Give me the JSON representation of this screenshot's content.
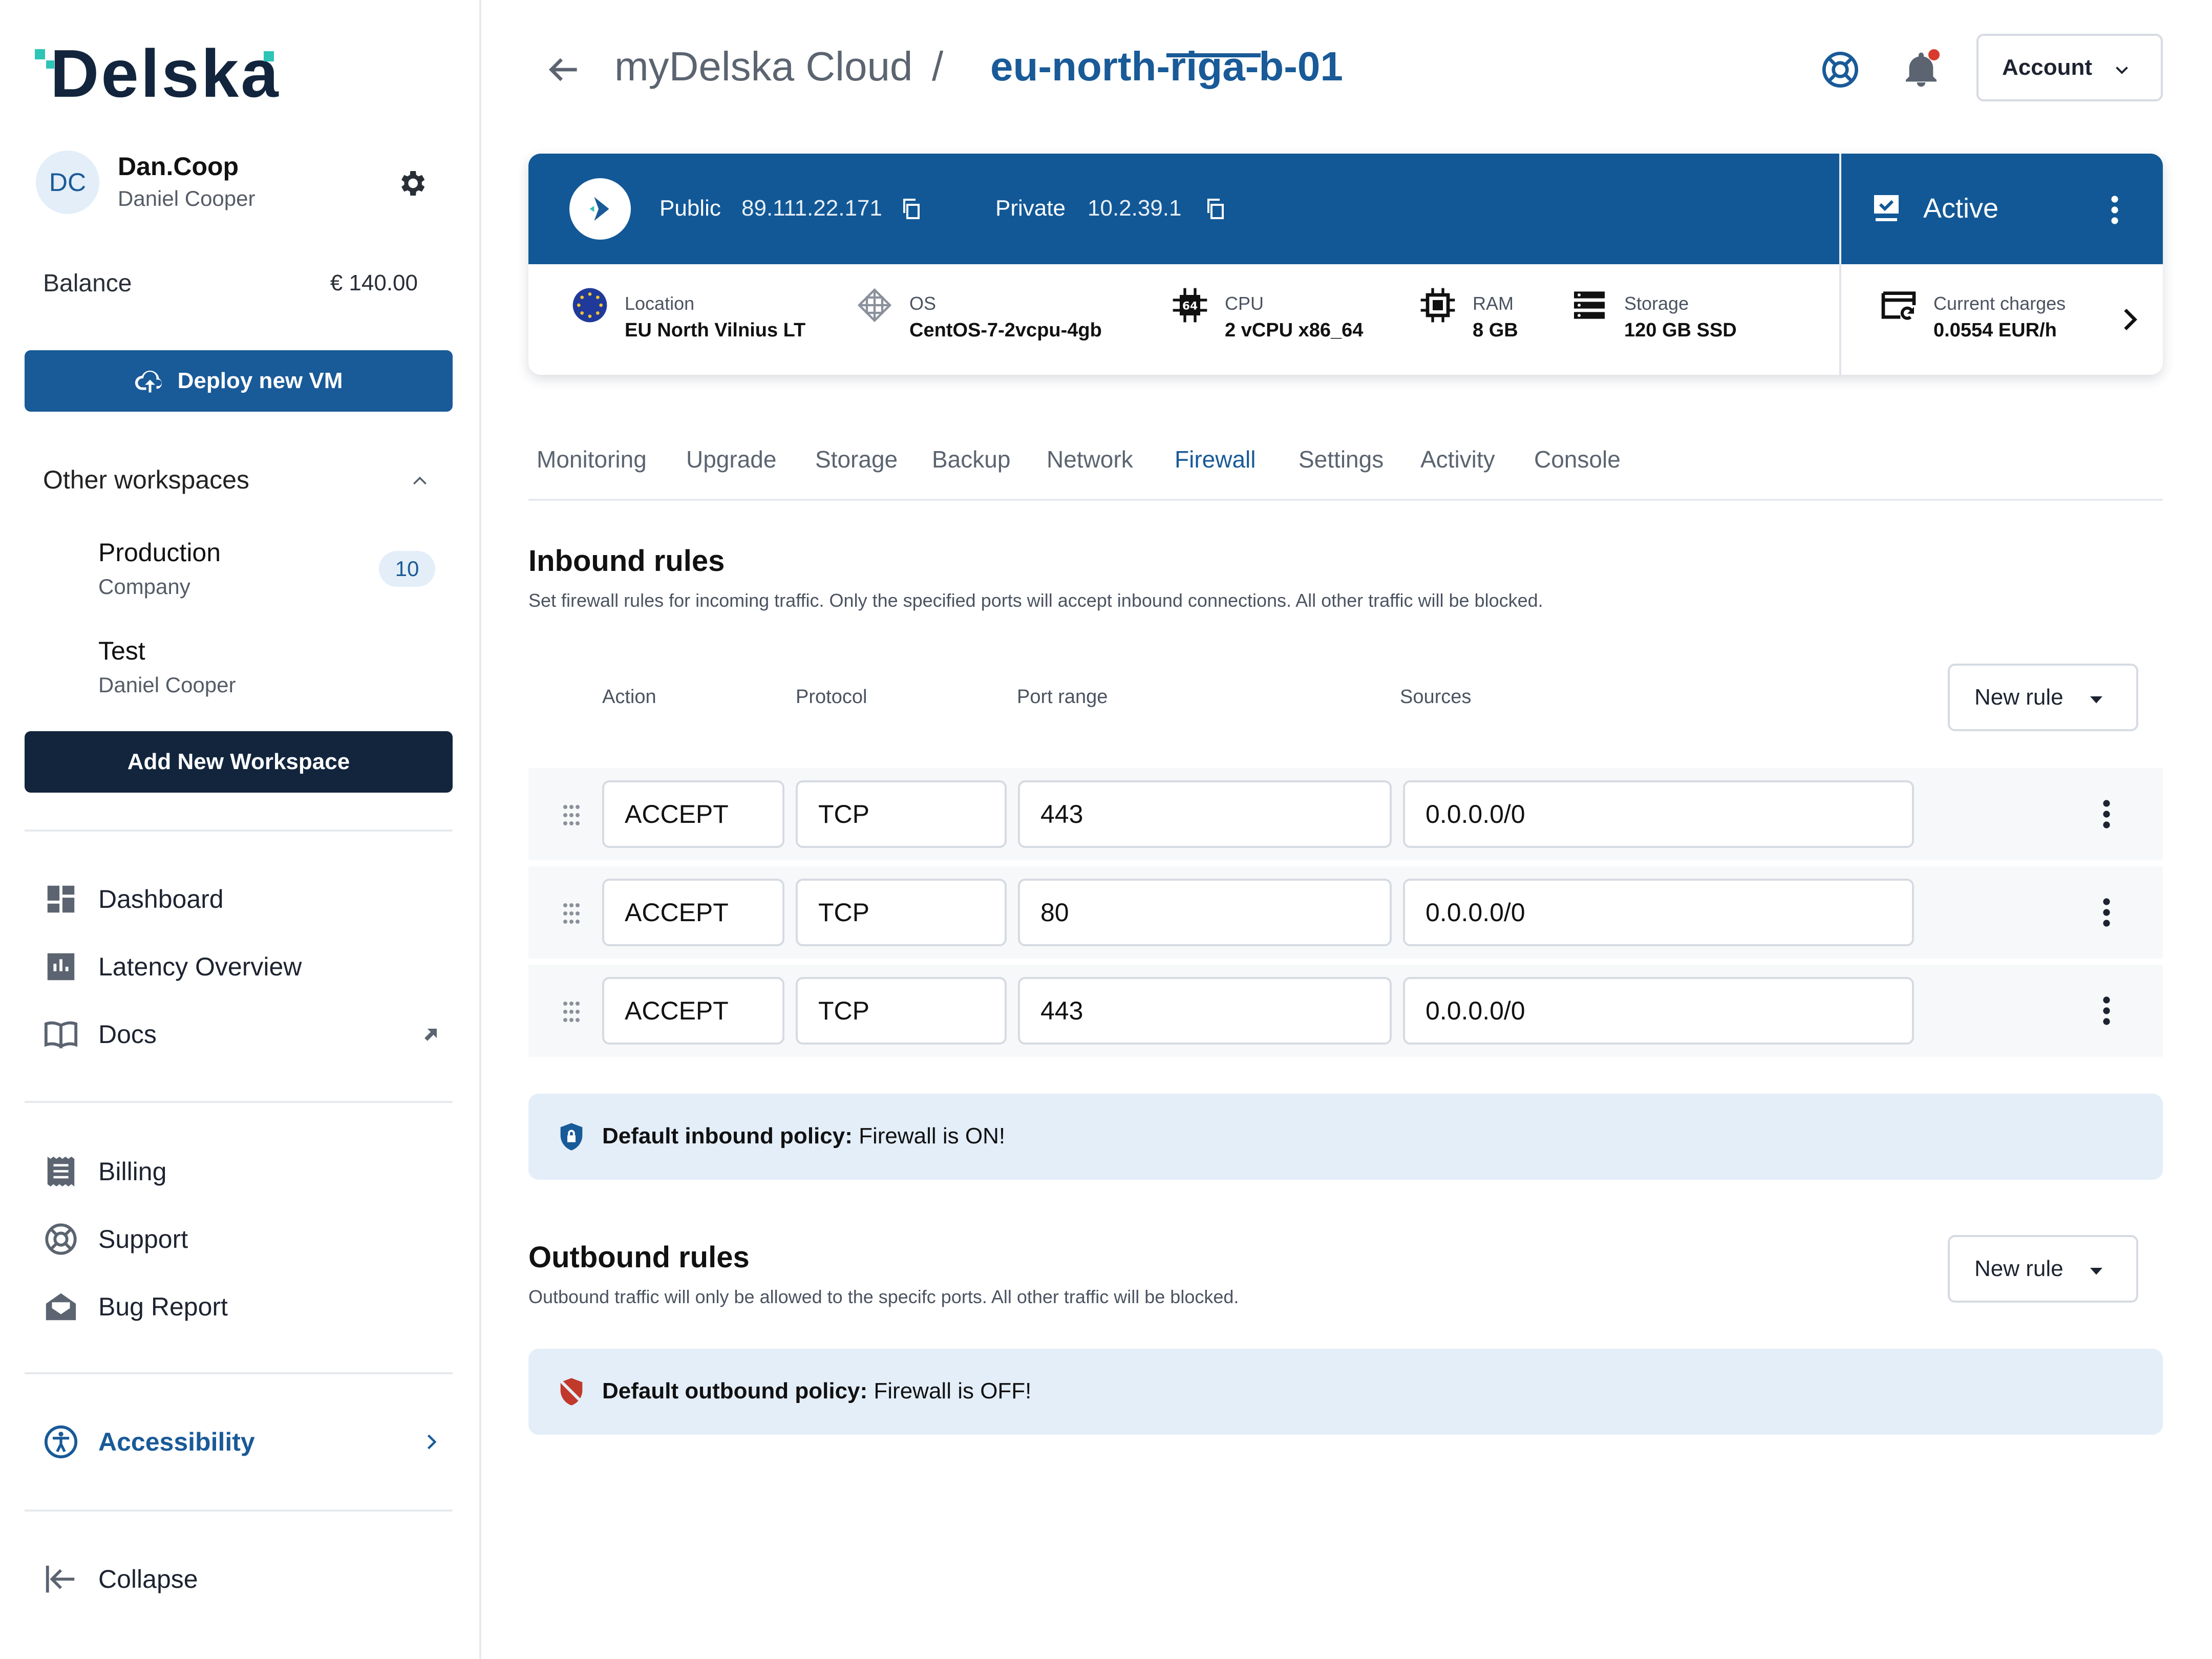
{
  "sidebar": {
    "logo": "Delska",
    "user": {
      "initials": "DC",
      "name": "Dan.Coop",
      "full_name": "Daniel Cooper"
    },
    "balance": {
      "label": "Balance",
      "value": "€ 140.00"
    },
    "deploy_label": "Deploy new VM",
    "other_workspaces_label": "Other workspaces",
    "workspaces": [
      {
        "name": "Production",
        "sub": "Company",
        "badge": "10"
      },
      {
        "name": "Test",
        "sub": "Daniel Cooper"
      }
    ],
    "add_workspace_label": "Add New Workspace",
    "nav_main": [
      {
        "label": "Dashboard",
        "icon": "dashboard-icon"
      },
      {
        "label": "Latency Overview",
        "icon": "bar-chart-icon"
      },
      {
        "label": "Docs",
        "icon": "book-icon"
      }
    ],
    "nav_secondary": [
      {
        "label": "Billing",
        "icon": "receipt-icon"
      },
      {
        "label": "Support",
        "icon": "lifebuoy-icon"
      },
      {
        "label": "Bug Report",
        "icon": "mail-icon"
      }
    ],
    "accessibility_label": "Accessibility",
    "collapse_label": "Collapse"
  },
  "header": {
    "crumb_root": "myDelska Cloud",
    "crumb_sep": "/",
    "crumb_current": "eu-north-riga-b-01",
    "account_label": "Account"
  },
  "vm": {
    "public_label": "Public",
    "public_ip": "89.111.22.171",
    "private_label": "Private",
    "private_ip": "10.2.39.1",
    "status": "Active",
    "specs": [
      {
        "label": "Location",
        "value": "EU North Vilnius LT"
      },
      {
        "label": "OS",
        "value": "CentOS-7-2vcpu-4gb"
      },
      {
        "label": "CPU",
        "value": "2 vCPU x86_64"
      },
      {
        "label": "RAM",
        "value": "8 GB"
      },
      {
        "label": "Storage",
        "value": "120 GB SSD"
      }
    ],
    "charges_label": "Current charges",
    "charges_value": "0.0554 EUR/h"
  },
  "tabs": [
    "Monitoring",
    "Upgrade",
    "Storage",
    "Backup",
    "Network",
    "Firewall",
    "Settings",
    "Activity",
    "Console"
  ],
  "active_tab": "Firewall",
  "inbound": {
    "title": "Inbound rules",
    "description": "Set firewall rules for incoming traffic. Only the specified ports will accept inbound connections. All other traffic will be blocked.",
    "columns": [
      "Action",
      "Protocol",
      "Port range",
      "Sources"
    ],
    "new_rule_label": "New rule",
    "rules": [
      {
        "action": "ACCEPT",
        "protocol": "TCP",
        "port": "443",
        "source": "0.0.0.0/0"
      },
      {
        "action": "ACCEPT",
        "protocol": "TCP",
        "port": "80",
        "source": "0.0.0.0/0"
      },
      {
        "action": "ACCEPT",
        "protocol": "TCP",
        "port": "443",
        "source": "0.0.0.0/0"
      }
    ],
    "policy_label": "Default inbound policy:",
    "policy_value": "Firewall is ON!"
  },
  "outbound": {
    "title": "Outbound rules",
    "description": "Outbound traffic will only be allowed to the specifc ports. All other traffic will be blocked.",
    "new_rule_label": "New rule",
    "policy_label": "Default outbound policy:",
    "policy_value": "Firewall is OFF!"
  },
  "colors": {
    "primary": "#195a98",
    "dark": "#12253d",
    "accent": "#2ec4b6",
    "alert": "#d93a2e",
    "info_bg": "#e3eef9"
  }
}
